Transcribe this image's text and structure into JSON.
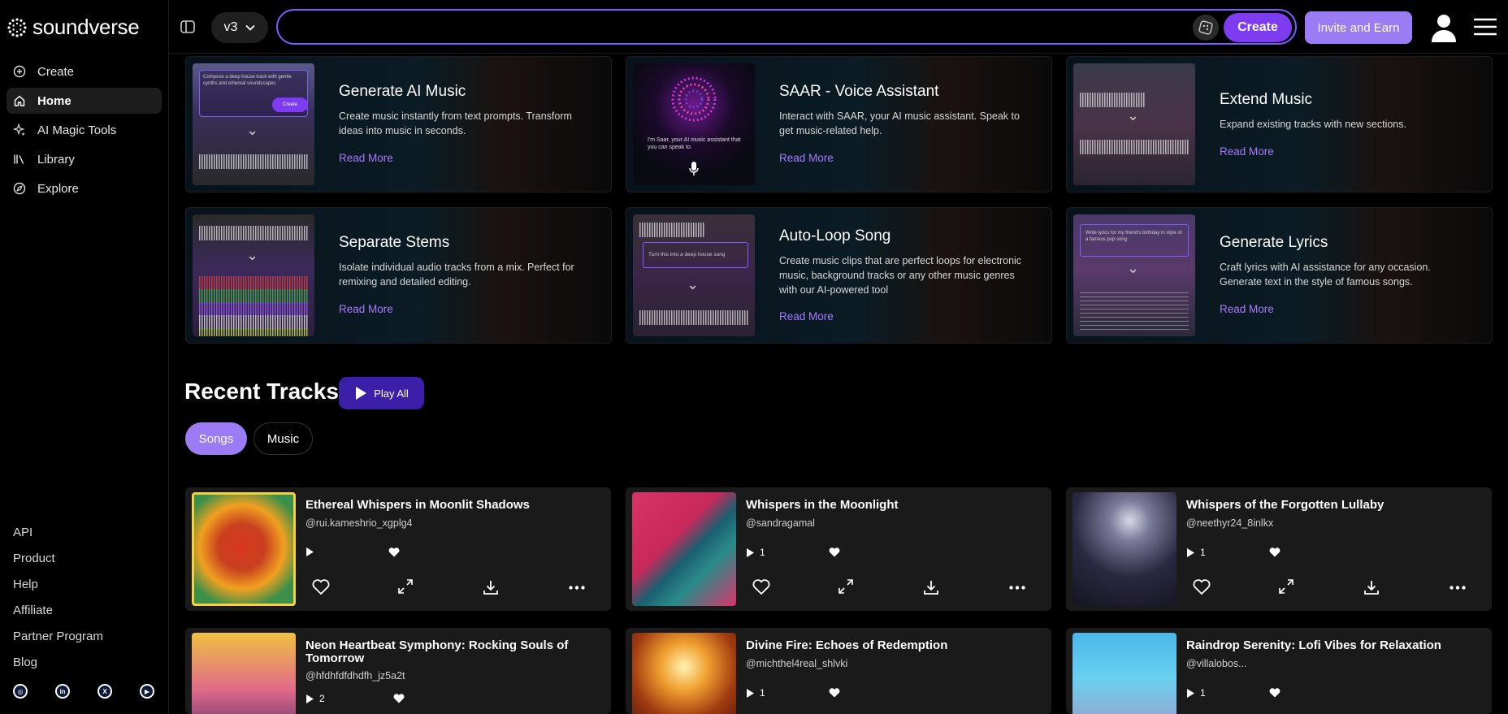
{
  "brand": {
    "name": "soundverse"
  },
  "nav": [
    {
      "label": "Create",
      "icon": "plus-circle-icon"
    },
    {
      "label": "Home",
      "icon": "home-icon"
    },
    {
      "label": "AI Magic Tools",
      "icon": "sparkle-icon"
    },
    {
      "label": "Library",
      "icon": "library-icon"
    },
    {
      "label": "Explore",
      "icon": "compass-icon"
    }
  ],
  "footer_links": [
    "API",
    "Product",
    "Help",
    "Affiliate",
    "Partner Program",
    "Blog"
  ],
  "socials": [
    "instagram-icon",
    "linkedin-icon",
    "x-icon",
    "youtube-icon"
  ],
  "topbar": {
    "version": "v3",
    "prompt_value": "",
    "create_label": "Create",
    "invite_label": "Invite and Earn"
  },
  "features": [
    {
      "title": "Generate AI Music",
      "desc": "Create music instantly from text prompts. Transform ideas into music in seconds.",
      "more": "Read More",
      "thumb_text": "Compose a deep house track with gentle synths and ethereal soundscapes",
      "thumb_btn": "Create"
    },
    {
      "title": "SAAR - Voice Assistant",
      "desc": "Interact with SAAR, your AI music assistant. Speak to get music-related help.",
      "more": "Read More",
      "thumb_text": "I'm Saar, your AI music assistant that you can speak to."
    },
    {
      "title": "Extend Music",
      "desc": "Expand existing tracks with new sections.",
      "more": "Read More"
    },
    {
      "title": "Separate Stems",
      "desc": "Isolate individual audio tracks from a mix. Perfect for remixing and detailed editing.",
      "more": "Read More"
    },
    {
      "title": "Auto-Loop Song",
      "desc": "Create music clips that are perfect loops for electronic music, background tracks or any other music genres with our AI-powered tool",
      "more": "Read More",
      "thumb_text": "Turn this into a deep house song"
    },
    {
      "title": "Generate Lyrics",
      "desc": "Craft lyrics with AI assistance for any occasion. Generate text in the style of famous songs.",
      "more": "Read More",
      "thumb_text": "Write lyrics for my friend's birthday in style of a famous pop song"
    }
  ],
  "recent": {
    "title": "Recent Tracks",
    "play_all": "Play All",
    "tabs": [
      "Songs",
      "Music"
    ]
  },
  "tracks": [
    {
      "title": "Ethereal Whispers in Moonlit Shadows",
      "user": "@rui.kameshrio_xgplg4",
      "plays": ""
    },
    {
      "title": "Whispers in the Moonlight",
      "user": "@sandragamal",
      "plays": "1"
    },
    {
      "title": "Whispers of the Forgotten Lullaby",
      "user": "@neethyr24_8inlkx",
      "plays": "1"
    },
    {
      "title": "Neon Heartbeat Symphony: Rocking Souls of Tomorrow",
      "user": "@hfdhfdfdhdfh_jz5a2t",
      "plays": "2"
    },
    {
      "title": "Divine Fire: Echoes of Redemption",
      "user": "@michthel4real_shlvki",
      "plays": "1"
    },
    {
      "title": "Raindrop Serenity: Lofi Vibes for Relaxation",
      "user": "@villalobos...",
      "plays": "1"
    }
  ],
  "colors": {
    "accent": "#7d3cf0",
    "accent_light": "#9b7cf5",
    "link": "#a77bff",
    "card_bg": "#1a1a1a"
  }
}
